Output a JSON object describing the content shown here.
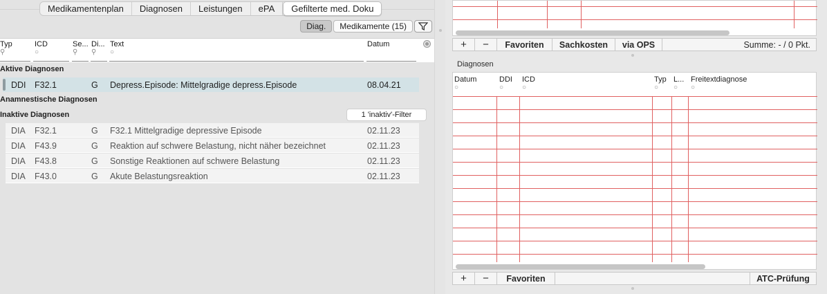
{
  "tabs": [
    {
      "label": "Medikamentenplan",
      "selected": false
    },
    {
      "label": "Diagnosen",
      "selected": false
    },
    {
      "label": "Leistungen",
      "selected": false
    },
    {
      "label": "ePA",
      "selected": false
    },
    {
      "label": "Gefilterte med. Doku",
      "selected": true
    }
  ],
  "toolbar": {
    "diag_label": "Diag.",
    "medikamente_label": "Medikamente (15)",
    "filter_icon": "funnel-icon"
  },
  "columns": {
    "typ": "Typ",
    "icd": "ICD",
    "se": "Se...",
    "di": "Di...",
    "text": "Text",
    "datum": "Datum"
  },
  "groups": {
    "aktive": "Aktive Diagnosen",
    "anamnestische": "Anamnestische Diagnosen",
    "inaktive": "Inaktive Diagnosen",
    "inaktiv_filter": "1 'inaktiv'-Filter"
  },
  "active_rows": [
    {
      "typ": "DDI",
      "icd": "F32.1",
      "di": "G",
      "text": "Depress.Episode: Mittelgradige depress.Episode",
      "datum": "08.04.21"
    }
  ],
  "inactive_rows": [
    {
      "typ": "DIA",
      "icd": "F32.1",
      "di": "G",
      "text": "F32.1 Mittelgradige depressive Episode",
      "datum": "02.11.23"
    },
    {
      "typ": "DIA",
      "icd": "F43.9",
      "di": "G",
      "text": "Reaktion auf schwere Belastung, nicht näher bezeichnet",
      "datum": "02.11.23"
    },
    {
      "typ": "DIA",
      "icd": "F43.8",
      "di": "G",
      "text": "Sonstige Reaktionen auf schwere Belastung",
      "datum": "02.11.23"
    },
    {
      "typ": "DIA",
      "icd": "F43.0",
      "di": "G",
      "text": "Akute Belastungsreaktion",
      "datum": "02.11.23"
    }
  ],
  "right_top": {
    "buttons": {
      "add": "+",
      "remove": "−",
      "favoriten": "Favoriten",
      "sachkosten": "Sachkosten",
      "via_ops": "via OPS"
    },
    "summe": "Summe: - / 0 Pkt."
  },
  "right_diag": {
    "title": "Diagnosen",
    "columns": {
      "datum": "Datum",
      "ddi": "DDI",
      "icd": "ICD",
      "typ": "Typ",
      "l": "L...",
      "freitext": "Freitextdiagnose"
    },
    "buttons": {
      "add": "+",
      "remove": "−",
      "favoriten": "Favoriten",
      "atc": "ATC-Prüfung"
    }
  },
  "colors": {
    "accent_red": "#e06060",
    "active_row": "#d3e2e6"
  }
}
